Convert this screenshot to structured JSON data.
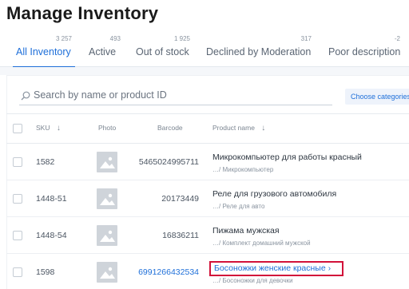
{
  "page": {
    "title": "Manage Inventory"
  },
  "tabs": [
    {
      "label": "All Inventory",
      "count": "3 257",
      "active": true
    },
    {
      "label": "Active",
      "count": "493",
      "active": false
    },
    {
      "label": "Out of stock",
      "count": "1 925",
      "active": false
    },
    {
      "label": "Declined by Moderation",
      "count": "317",
      "active": false
    },
    {
      "label": "Poor description",
      "count": "-2",
      "active": false
    }
  ],
  "search": {
    "placeholder": "Search by name or product ID",
    "value": ""
  },
  "choose_categories_label": "Choose categories",
  "table": {
    "headers": {
      "sku": "SKU",
      "photo": "Photo",
      "barcode": "Barcode",
      "product_name": "Product name"
    },
    "rows": [
      {
        "sku": "1582",
        "barcode": "5465024995711",
        "name": "Микрокомпьютер для работы красный",
        "category": "…/ Микрокомпьютер"
      },
      {
        "sku": "1448-51",
        "barcode": "20173449",
        "name": "Реле для грузового автомобиля",
        "category": "…/ Реле для авто"
      },
      {
        "sku": "1448-54",
        "barcode": "16836211",
        "name": "Пижама мужская",
        "category": "…/ Комплект домашний мужской"
      },
      {
        "sku": "1598",
        "barcode": "6991266432534",
        "name": "Босоножки женские красные",
        "category": "…/ Босоножки для девочки"
      }
    ]
  },
  "colors": {
    "accent": "#1e6fd9",
    "highlight": "#d2123a"
  }
}
